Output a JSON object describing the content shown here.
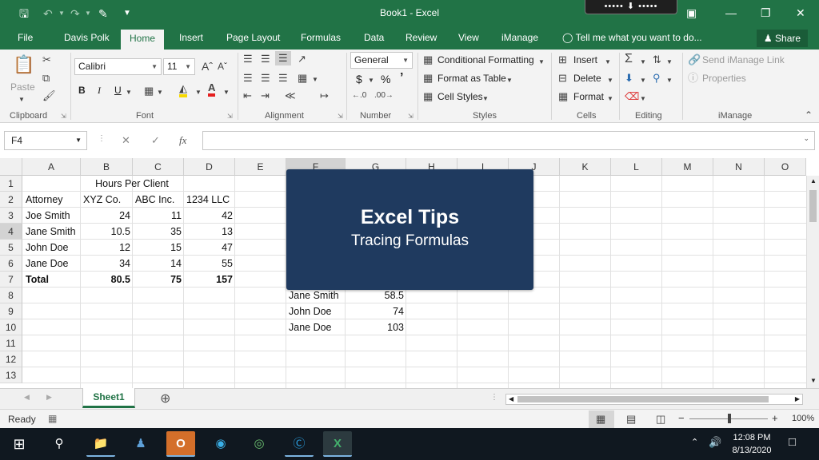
{
  "window": {
    "title": "Book1 - Excel",
    "presenter_bar": "••••• ⬇ •••••",
    "qat_icons": [
      "save-icon",
      "undo-icon",
      "redo-icon",
      "print-preview-icon",
      "customize-qat-icon"
    ],
    "controls": [
      "ribbon-display-icon",
      "minimize-icon",
      "restore-icon",
      "close-icon"
    ]
  },
  "tabs": [
    "File",
    "Davis Polk",
    "Home",
    "Insert",
    "Page Layout",
    "Formulas",
    "Data",
    "Review",
    "View",
    "iManage"
  ],
  "active_tab": "Home",
  "tell_me": "Tell me what you want to do...",
  "share": "Share",
  "ribbon": {
    "clipboard": {
      "paste": "Paste",
      "label": "Clipboard"
    },
    "font": {
      "name": "Calibri",
      "size": "11",
      "bold": "B",
      "italic": "I",
      "underline": "U",
      "label": "Font"
    },
    "alignment": {
      "label": "Alignment"
    },
    "number": {
      "format": "General",
      "currency": "$",
      "percent": "%",
      "comma": "’",
      "label": "Number"
    },
    "styles": {
      "conditional": "Conditional Formatting",
      "table": "Format as Table",
      "cell_styles": "Cell Styles",
      "label": "Styles"
    },
    "cells": {
      "insert": "Insert",
      "delete": "Delete",
      "format": "Format",
      "label": "Cells"
    },
    "editing": {
      "label": "Editing"
    },
    "imanage": {
      "send_link": "Send iManage Link",
      "properties": "Properties",
      "label": "iManage"
    }
  },
  "formula_bar": {
    "name_box": "F4",
    "cancel": "✕",
    "enter": "✓",
    "fx": "fx",
    "value": ""
  },
  "columns": [
    "A",
    "B",
    "C",
    "D",
    "E",
    "F",
    "G",
    "H",
    "I",
    "J",
    "K",
    "L",
    "M",
    "N",
    "O"
  ],
  "rows": [
    "1",
    "2",
    "3",
    "4",
    "5",
    "6",
    "7",
    "8",
    "9",
    "10",
    "11",
    "12",
    "13"
  ],
  "cells": {
    "title": "Hours Per Client",
    "headers": [
      "Attorney",
      "XYZ Co.",
      "ABC Inc.",
      "1234 LLC"
    ],
    "data": [
      [
        "Joe Smith",
        "24",
        "11",
        "42"
      ],
      [
        "Jane Smith",
        "10.5",
        "35",
        "13"
      ],
      [
        "John Doe",
        "12",
        "15",
        "47"
      ],
      [
        "Jane Doe",
        "34",
        "14",
        "55"
      ]
    ],
    "total": [
      "Total",
      "80.5",
      "75",
      "157"
    ],
    "summary": [
      [
        "Jane Smith",
        "58.5"
      ],
      [
        "John Doe",
        "74"
      ],
      [
        "Jane Doe",
        "103"
      ]
    ]
  },
  "overlay": {
    "title": "Excel Tips",
    "subtitle": "Tracing Formulas"
  },
  "sheet_tabs": [
    "Sheet1"
  ],
  "status": {
    "ready": "Ready",
    "zoom": "100%",
    "zoom_minus": "−",
    "zoom_plus": "+"
  },
  "taskbar": {
    "time": "12:08 PM",
    "date": "8/13/2020",
    "apps": [
      "start-icon",
      "search-icon",
      "file-explorer-icon",
      "teams-icon",
      "outlook-icon",
      "edge-icon",
      "browser-icon",
      "skype-icon",
      "excel-icon"
    ]
  }
}
